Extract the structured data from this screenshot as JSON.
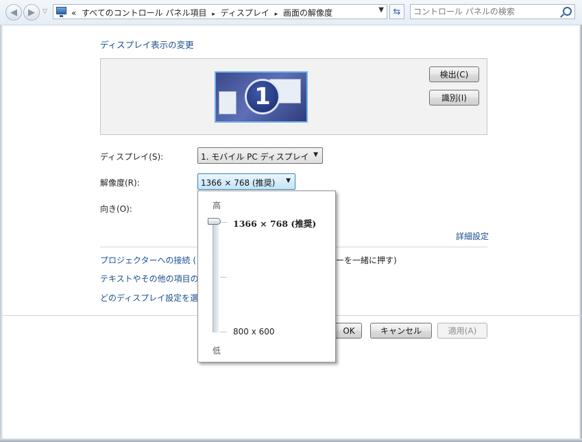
{
  "breadcrumb": {
    "prefix": "«",
    "items": [
      "すべてのコントロール パネル項目",
      "ディスプレイ",
      "画面の解像度"
    ],
    "separator": "▸"
  },
  "search": {
    "placeholder": "コントロール パネルの検索"
  },
  "heading": "ディスプレイ表示の変更",
  "preview": {
    "monitor_number": "1",
    "detect_button": "検出(C)",
    "identify_button": "識別(I)"
  },
  "form": {
    "display_label": "ディスプレイ(S):",
    "display_value": "1. モバイル PC ディスプレイ",
    "resolution_label": "解像度(R):",
    "resolution_value": "1366 × 768 (推奨)",
    "orientation_label": "向き(O):"
  },
  "resolution_popup": {
    "high_label": "高",
    "low_label": "低",
    "max_option": "1366 × 768 (推奨)",
    "min_option": "800 x 600",
    "slider_position": 1.0
  },
  "links": {
    "advanced": "詳細設定",
    "projector": "プロジェクターへの接続 (",
    "projector_tail": "ーを一緒に押す)",
    "text_size": "テキストやその他の項目の",
    "which_settings": "どのディスプレイ設定を選"
  },
  "buttons": {
    "ok": "OK",
    "cancel": "キャンセル",
    "apply": "適用(A)"
  }
}
